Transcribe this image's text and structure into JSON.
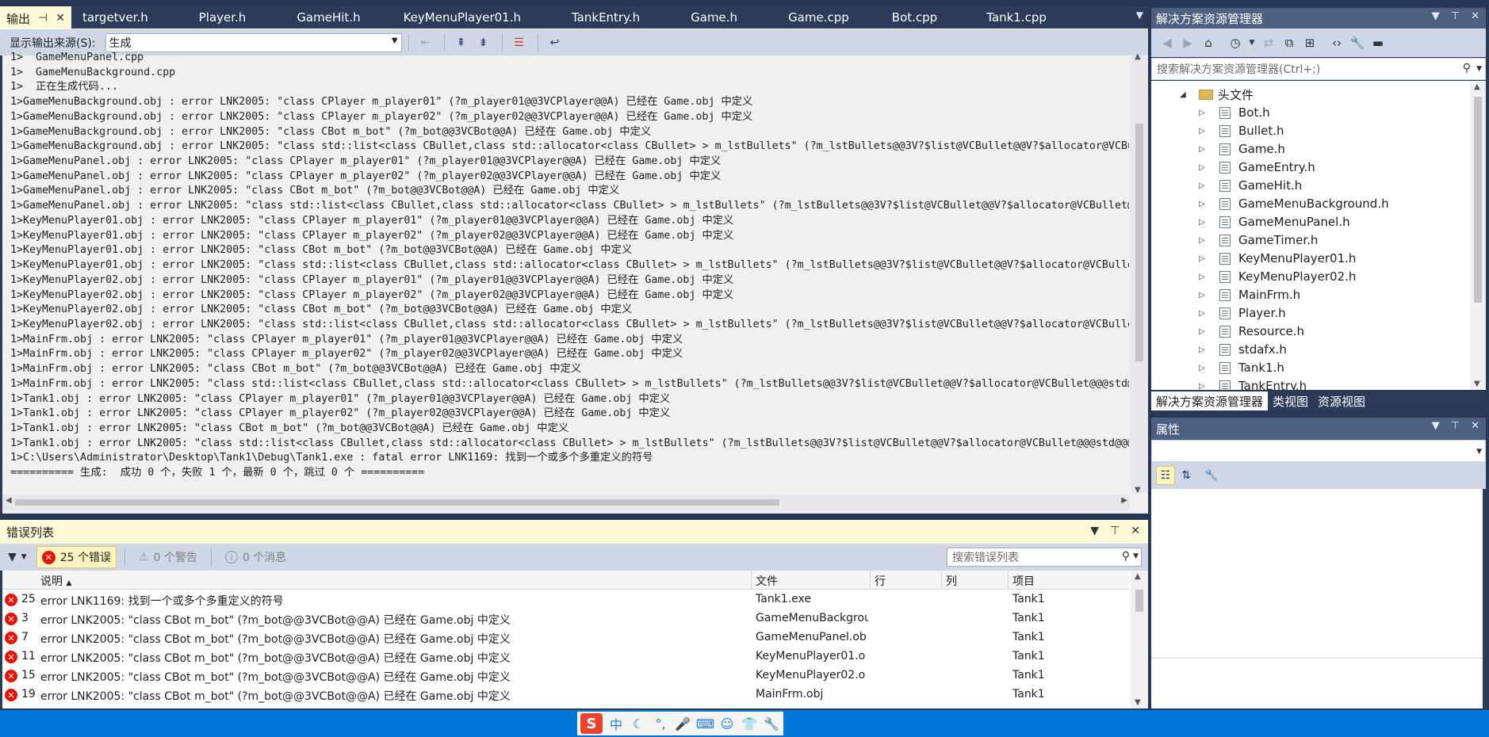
{
  "output_panel": {
    "tab_label": "输出",
    "tab_pin": "⊣",
    "tab_close": "✕",
    "doc_tabs": [
      "targetver.h",
      "Player.h",
      "GameHit.h",
      "KeyMenuPlayer01.h",
      "TankEntry.h",
      "Game.h",
      "Game.cpp",
      "Bot.cpp",
      "Tank1.cpp"
    ],
    "source_label": "显示输出来源(S):",
    "source_value": "生成",
    "lines": [
      "1>  GameMenuPanel.cpp",
      "1>  GameMenuBackground.cpp",
      "1>  正在生成代码...",
      "1>GameMenuBackground.obj : error LNK2005: \"class CPlayer m_player01\" (?m_player01@@3VCPlayer@@A) 已经在 Game.obj 中定义",
      "1>GameMenuBackground.obj : error LNK2005: \"class CPlayer m_player02\" (?m_player02@@3VCPlayer@@A) 已经在 Game.obj 中定义",
      "1>GameMenuBackground.obj : error LNK2005: \"class CBot m_bot\" (?m_bot@@3VCBot@@A) 已经在 Game.obj 中定义",
      "1>GameMenuBackground.obj : error LNK2005: \"class std::list<class CBullet,class std::allocator<class CBullet> > m_lstBullets\" (?m_lstBullets@@3V?$list@VCBullet@@V?$allocator@VCBullet@@@std@@@std@@A)",
      "1>GameMenuPanel.obj : error LNK2005: \"class CPlayer m_player01\" (?m_player01@@3VCPlayer@@A) 已经在 Game.obj 中定义",
      "1>GameMenuPanel.obj : error LNK2005: \"class CPlayer m_player02\" (?m_player02@@3VCPlayer@@A) 已经在 Game.obj 中定义",
      "1>GameMenuPanel.obj : error LNK2005: \"class CBot m_bot\" (?m_bot@@3VCBot@@A) 已经在 Game.obj 中定义",
      "1>GameMenuPanel.obj : error LNK2005: \"class std::list<class CBullet,class std::allocator<class CBullet> > m_lstBullets\" (?m_lstBullets@@3V?$list@VCBullet@@V?$allocator@VCBullet@@@std@@@std@@A)",
      "1>KeyMenuPlayer01.obj : error LNK2005: \"class CPlayer m_player01\" (?m_player01@@3VCPlayer@@A) 已经在 Game.obj 中定义",
      "1>KeyMenuPlayer01.obj : error LNK2005: \"class CPlayer m_player02\" (?m_player02@@3VCPlayer@@A) 已经在 Game.obj 中定义",
      "1>KeyMenuPlayer01.obj : error LNK2005: \"class CBot m_bot\" (?m_bot@@3VCBot@@A) 已经在 Game.obj 中定义",
      "1>KeyMenuPlayer01.obj : error LNK2005: \"class std::list<class CBullet,class std::allocator<class CBullet> > m_lstBullets\" (?m_lstBullets@@3V?$list@VCBullet@@V?$allocator@VCBullet@@@std@@@std@@A)",
      "1>KeyMenuPlayer02.obj : error LNK2005: \"class CPlayer m_player01\" (?m_player01@@3VCPlayer@@A) 已经在 Game.obj 中定义",
      "1>KeyMenuPlayer02.obj : error LNK2005: \"class CPlayer m_player02\" (?m_player02@@3VCPlayer@@A) 已经在 Game.obj 中定义",
      "1>KeyMenuPlayer02.obj : error LNK2005: \"class CBot m_bot\" (?m_bot@@3VCBot@@A) 已经在 Game.obj 中定义",
      "1>KeyMenuPlayer02.obj : error LNK2005: \"class std::list<class CBullet,class std::allocator<class CBullet> > m_lstBullets\" (?m_lstBullets@@3V?$list@VCBullet@@V?$allocator@VCBullet@@@std@@@std@@A)",
      "1>MainFrm.obj : error LNK2005: \"class CPlayer m_player01\" (?m_player01@@3VCPlayer@@A) 已经在 Game.obj 中定义",
      "1>MainFrm.obj : error LNK2005: \"class CPlayer m_player02\" (?m_player02@@3VCPlayer@@A) 已经在 Game.obj 中定义",
      "1>MainFrm.obj : error LNK2005: \"class CBot m_bot\" (?m_bot@@3VCBot@@A) 已经在 Game.obj 中定义",
      "1>MainFrm.obj : error LNK2005: \"class std::list<class CBullet,class std::allocator<class CBullet> > m_lstBullets\" (?m_lstBullets@@3V?$list@VCBullet@@V?$allocator@VCBullet@@@std@@@std@@A)",
      "1>Tank1.obj : error LNK2005: \"class CPlayer m_player01\" (?m_player01@@3VCPlayer@@A) 已经在 Game.obj 中定义",
      "1>Tank1.obj : error LNK2005: \"class CPlayer m_player02\" (?m_player02@@3VCPlayer@@A) 已经在 Game.obj 中定义",
      "1>Tank1.obj : error LNK2005: \"class CBot m_bot\" (?m_bot@@3VCBot@@A) 已经在 Game.obj 中定义",
      "1>Tank1.obj : error LNK2005: \"class std::list<class CBullet,class std::allocator<class CBullet> > m_lstBullets\" (?m_lstBullets@@3V?$list@VCBullet@@V?$allocator@VCBullet@@@std@@@std@@A)",
      "1>C:\\Users\\Administrator\\Desktop\\Tank1\\Debug\\Tank1.exe : fatal error LNK1169: 找到一个或多个多重定义的符号",
      "========== 生成:  成功 0 个，失败 1 个，最新 0 个，跳过 0 个 =========="
    ]
  },
  "error_list": {
    "title": "错误列表",
    "errors_filter": "25 个错误",
    "warnings_filter": "0 个警告",
    "messages_filter": "0 个消息",
    "search_placeholder": "搜索错误列表",
    "headers": {
      "desc": "说明",
      "file": "文件",
      "line": "行",
      "col": "列",
      "project": "项目"
    },
    "rows": [
      {
        "num": "25",
        "desc": "error LNK1169: 找到一个或多个多重定义的符号",
        "file": "Tank1.exe",
        "project": "Tank1"
      },
      {
        "num": "3",
        "desc": "error LNK2005: \"class CBot m_bot\" (?m_bot@@3VCBot@@A) 已经在 Game.obj 中定义",
        "file": "GameMenuBackgrou",
        "project": "Tank1"
      },
      {
        "num": "7",
        "desc": "error LNK2005: \"class CBot m_bot\" (?m_bot@@3VCBot@@A) 已经在 Game.obj 中定义",
        "file": "GameMenuPanel.ob",
        "project": "Tank1"
      },
      {
        "num": "11",
        "desc": "error LNK2005: \"class CBot m_bot\" (?m_bot@@3VCBot@@A) 已经在 Game.obj 中定义",
        "file": "KeyMenuPlayer01.o",
        "project": "Tank1"
      },
      {
        "num": "15",
        "desc": "error LNK2005: \"class CBot m_bot\" (?m_bot@@3VCBot@@A) 已经在 Game.obj 中定义",
        "file": "KeyMenuPlayer02.o",
        "project": "Tank1"
      },
      {
        "num": "19",
        "desc": "error LNK2005: \"class CBot m_bot\" (?m_bot@@3VCBot@@A) 已经在 Game.obj 中定义",
        "file": "MainFrm.obj",
        "project": "Tank1"
      }
    ]
  },
  "solution_explorer": {
    "title": "解决方案资源管理器",
    "search_placeholder": "搜索解决方案资源管理器(Ctrl+;)",
    "folder": "头文件",
    "files": [
      "Bot.h",
      "Bullet.h",
      "Game.h",
      "GameEntry.h",
      "GameHit.h",
      "GameMenuBackground.h",
      "GameMenuPanel.h",
      "GameTimer.h",
      "KeyMenuPlayer01.h",
      "KeyMenuPlayer02.h",
      "MainFrm.h",
      "Player.h",
      "Resource.h",
      "stdafx.h",
      "Tank1.h",
      "TankEntry.h"
    ],
    "tabs": [
      "解决方案资源管理器",
      "类视图",
      "资源视图"
    ]
  },
  "properties": {
    "title": "属性"
  },
  "taskbar": {
    "ime_logo": "S",
    "ime_mode": "中"
  }
}
